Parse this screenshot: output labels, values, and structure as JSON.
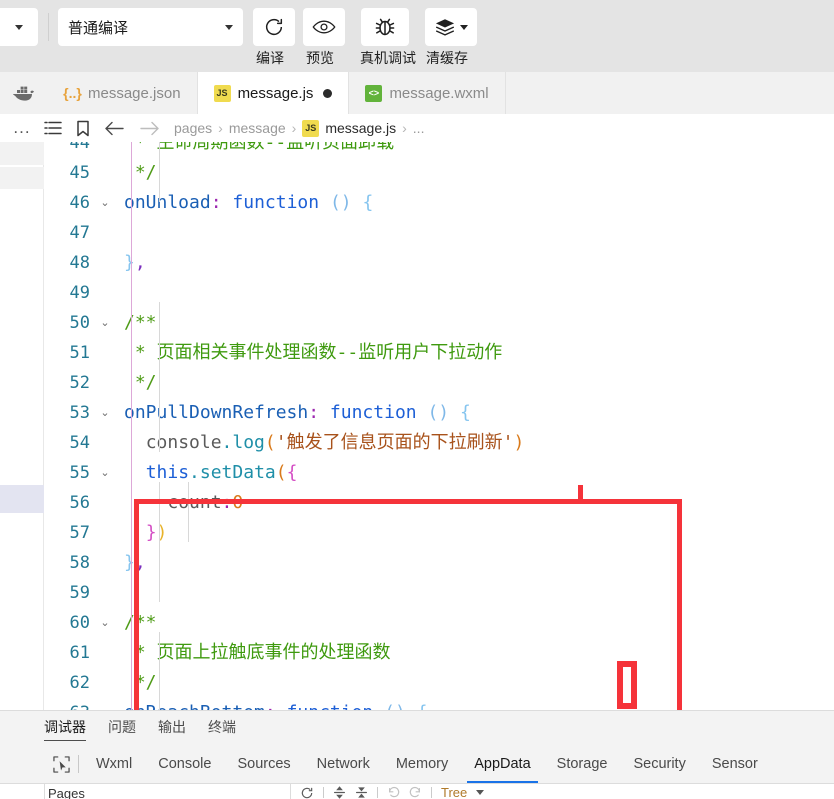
{
  "toolbar": {
    "left_menu_icon": "chevron-down-icon",
    "compile_mode_value": "普通编译",
    "compile_mode_caret": "chevron-down-icon",
    "actions": [
      {
        "icon": "refresh-icon",
        "label": "编译"
      },
      {
        "icon": "eye-icon",
        "label": "预览"
      },
      {
        "icon": "bug-icon",
        "label": "真机调试"
      },
      {
        "icon": "layers-icon",
        "label": "清缓存"
      }
    ]
  },
  "tabbar": {
    "app_icon": "docker-whale-icon",
    "tabs": [
      {
        "icon": "json-icon",
        "icon_text": "{..}",
        "label": "message.json",
        "active": false,
        "dirty": false
      },
      {
        "icon": "js-icon",
        "icon_text": "JS",
        "label": "message.js",
        "active": true,
        "dirty": true
      },
      {
        "icon": "wxml-icon",
        "icon_text": "<>",
        "label": "message.wxml",
        "active": false,
        "dirty": false
      }
    ]
  },
  "breadcrumb": {
    "overflow": "...",
    "icons": [
      "outline-list-icon",
      "bookmark-icon",
      "back-arrow-icon",
      "forward-arrow-icon"
    ],
    "crumbs": [
      "pages",
      "message"
    ],
    "file_icon_text": "JS",
    "file": "message.js",
    "trailing": "..."
  },
  "editor": {
    "first_line": 44,
    "lines": [
      {
        "no": 44,
        "fold": false,
        "clipped_top": true,
        "tokens": [
          {
            "t": "comment-green",
            "s": " * 生命周期函数--监听页面卸载"
          }
        ]
      },
      {
        "no": 45,
        "fold": false,
        "tokens": [
          {
            "t": "comment",
            "s": " */"
          }
        ]
      },
      {
        "no": 46,
        "fold": true,
        "tokens": [
          {
            "t": "prop",
            "s": "onUnload"
          },
          {
            "t": "colon",
            "s": ":"
          },
          {
            "t": "plain",
            "s": " "
          },
          {
            "t": "kw",
            "s": "function"
          },
          {
            "t": "plain",
            "s": " "
          },
          {
            "t": "paren-blue",
            "s": "()"
          },
          {
            "t": "plain",
            "s": " "
          },
          {
            "t": "brace-blue",
            "s": "{"
          }
        ]
      },
      {
        "no": 47,
        "fold": false,
        "tokens": []
      },
      {
        "no": 48,
        "fold": false,
        "tokens": [
          {
            "t": "brace-blue",
            "s": "}"
          },
          {
            "t": "punc",
            "s": ","
          }
        ]
      },
      {
        "no": 49,
        "fold": false,
        "tokens": []
      },
      {
        "no": 50,
        "fold": true,
        "tokens": [
          {
            "t": "comment",
            "s": "/**"
          }
        ]
      },
      {
        "no": 51,
        "fold": false,
        "tokens": [
          {
            "t": "comment",
            "s": " * "
          },
          {
            "t": "comment-green",
            "s": "页面相关事件处理函数--监听用户下拉动作"
          }
        ]
      },
      {
        "no": 52,
        "fold": false,
        "tokens": [
          {
            "t": "comment",
            "s": " */"
          }
        ]
      },
      {
        "no": 53,
        "fold": true,
        "tokens": [
          {
            "t": "prop",
            "s": "onPullDownRefresh"
          },
          {
            "t": "colon",
            "s": ":"
          },
          {
            "t": "plain",
            "s": " "
          },
          {
            "t": "kw",
            "s": "function"
          },
          {
            "t": "plain",
            "s": " "
          },
          {
            "t": "paren-blue",
            "s": "()"
          },
          {
            "t": "plain",
            "s": " "
          },
          {
            "t": "brace-blue",
            "s": "{"
          }
        ]
      },
      {
        "no": 54,
        "fold": false,
        "tokens": [
          {
            "t": "plain",
            "s": "  "
          },
          {
            "t": "dark",
            "s": "console"
          },
          {
            "t": "meth",
            "s": ".log"
          },
          {
            "t": "num",
            "s": "("
          },
          {
            "t": "str",
            "s": "'触发了信息页面的下拉刷新'"
          },
          {
            "t": "num",
            "s": ")"
          }
        ]
      },
      {
        "no": 55,
        "fold": true,
        "tokens": [
          {
            "t": "plain",
            "s": "  "
          },
          {
            "t": "this",
            "s": "this"
          },
          {
            "t": "meth",
            "s": ".setData"
          },
          {
            "t": "num",
            "s": "("
          },
          {
            "t": "brace-mag",
            "s": "{"
          }
        ]
      },
      {
        "no": 56,
        "fold": false,
        "tokens": [
          {
            "t": "plain",
            "s": "    "
          },
          {
            "t": "dark",
            "s": "count"
          },
          {
            "t": "colon2",
            "s": ":"
          },
          {
            "t": "num",
            "s": "0"
          }
        ]
      },
      {
        "no": 57,
        "fold": false,
        "tokens": [
          {
            "t": "plain",
            "s": "  "
          },
          {
            "t": "brace-mag",
            "s": "}"
          },
          {
            "t": "brace-yel",
            "s": ")"
          }
        ]
      },
      {
        "no": 58,
        "fold": false,
        "tokens": [
          {
            "t": "brace-blue",
            "s": "}"
          },
          {
            "t": "punc",
            "s": ","
          }
        ]
      },
      {
        "no": 59,
        "fold": false,
        "tokens": []
      },
      {
        "no": 60,
        "fold": true,
        "tokens": [
          {
            "t": "comment",
            "s": "/**"
          }
        ]
      },
      {
        "no": 61,
        "fold": false,
        "tokens": [
          {
            "t": "comment",
            "s": " * "
          },
          {
            "t": "comment-green",
            "s": "页面上拉触底事件的处理函数"
          }
        ]
      },
      {
        "no": 62,
        "fold": false,
        "tokens": [
          {
            "t": "comment",
            "s": " */"
          }
        ]
      },
      {
        "no": 63,
        "fold": true,
        "clipped_bottom": true,
        "tokens": [
          {
            "t": "prop",
            "s": "onReachBottom"
          },
          {
            "t": "colon",
            "s": ":"
          },
          {
            "t": "plain",
            "s": " "
          },
          {
            "t": "kw",
            "s": "function"
          },
          {
            "t": "plain",
            "s": " "
          },
          {
            "t": "paren-blue",
            "s": "()"
          },
          {
            "t": "plain",
            "s": " "
          },
          {
            "t": "brace-blue",
            "s": "{"
          }
        ]
      }
    ],
    "annotations": {
      "highlight_box_color": "#f5333a",
      "ibeam_marker_color": "#f5333a",
      "cursor_marker_color": "#f5333a"
    }
  },
  "panel": {
    "tabs": [
      {
        "label": "调试器",
        "active": true
      },
      {
        "label": "问题",
        "active": false
      },
      {
        "label": "输出",
        "active": false
      },
      {
        "label": "终端",
        "active": false
      }
    ],
    "devtools_pointer_icon": "inspect-cursor-icon",
    "devtools_tabs": [
      {
        "label": "Wxml",
        "active": false
      },
      {
        "label": "Console",
        "active": false
      },
      {
        "label": "Sources",
        "active": false
      },
      {
        "label": "Network",
        "active": false
      },
      {
        "label": "Memory",
        "active": false
      },
      {
        "label": "AppData",
        "active": true
      },
      {
        "label": "Storage",
        "active": false
      },
      {
        "label": "Security",
        "active": false
      },
      {
        "label": "Sensor",
        "active": false
      }
    ],
    "tree_panel_label": "Pages",
    "tree_toolbar": {
      "icons": [
        "refresh-icon",
        "expand-all-icon",
        "collapse-all-icon",
        "undo-icon",
        "redo-icon"
      ],
      "view_mode": "Tree",
      "view_caret": "chevron-down-icon"
    },
    "accent_color": "#1a73e8"
  }
}
